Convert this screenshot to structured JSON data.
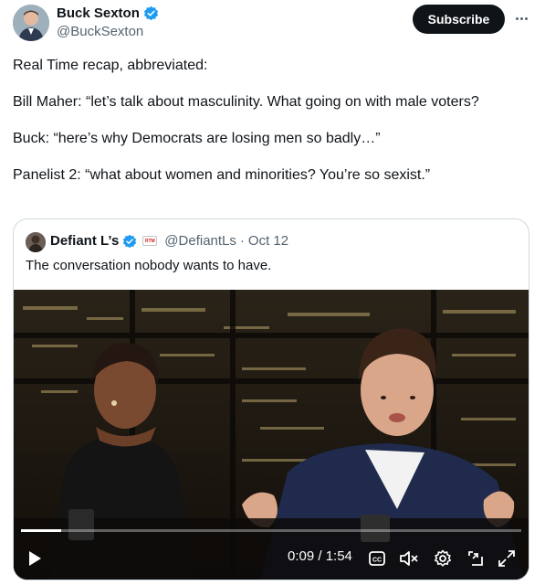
{
  "author": {
    "name": "Buck Sexton",
    "handle": "@BuckSexton",
    "verified_icon": "verified-badge-icon"
  },
  "actions": {
    "subscribe_label": "Subscribe",
    "more_icon": "more-options-icon"
  },
  "tweet": {
    "lines": [
      "Real Time recap, abbreviated:",
      "Bill Maher: “let’s talk about masculinity. What going on with male voters?",
      "Buck: “here’s why Democrats are losing men so badly…”",
      "Panelist 2: “what about women and minorities? You’re so sexist.”"
    ]
  },
  "quoted": {
    "name": "Defiant L’s",
    "badge_text": "RTM",
    "handle": "@DefiantLs",
    "separator": "·",
    "date": "Oct 12",
    "text": "The conversation nobody wants to have."
  },
  "video": {
    "time_label": "0:09 / 1:54",
    "progress": 0.08,
    "controls": [
      "play-icon",
      "captions-icon",
      "mute-icon",
      "settings-icon",
      "pip-icon",
      "fullscreen-icon"
    ]
  },
  "colors": {
    "accent": "#1d9bf0",
    "text": "#0f1419",
    "secondary": "#536471",
    "border": "#cfd9de"
  }
}
